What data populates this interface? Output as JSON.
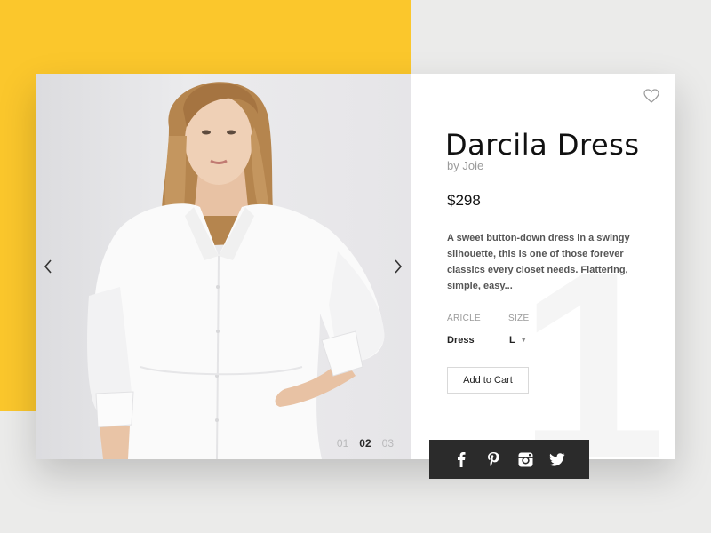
{
  "product": {
    "title": "Darcila Dress",
    "brand": "by Joie",
    "price": "$298",
    "description": "A sweet button-down dress in a swingy silhouette, this is one of those forever classics every closet needs. Flattering, simple, easy...",
    "big_number": "1"
  },
  "attributes": {
    "article_label": "ARICLE",
    "article_value": "Dress",
    "size_label": "SIZE",
    "size_value": "L"
  },
  "actions": {
    "add_to_cart_label": "Add to Cart"
  },
  "gallery": {
    "pages": [
      "01",
      "02",
      "03"
    ],
    "active_index": 1
  },
  "social": [
    "facebook-icon",
    "pinterest-icon",
    "instagram-icon",
    "twitter-icon"
  ],
  "colors": {
    "accent_yellow": "#fbc72c",
    "background": "#ebebea",
    "social_bar": "#2b2b2b"
  }
}
